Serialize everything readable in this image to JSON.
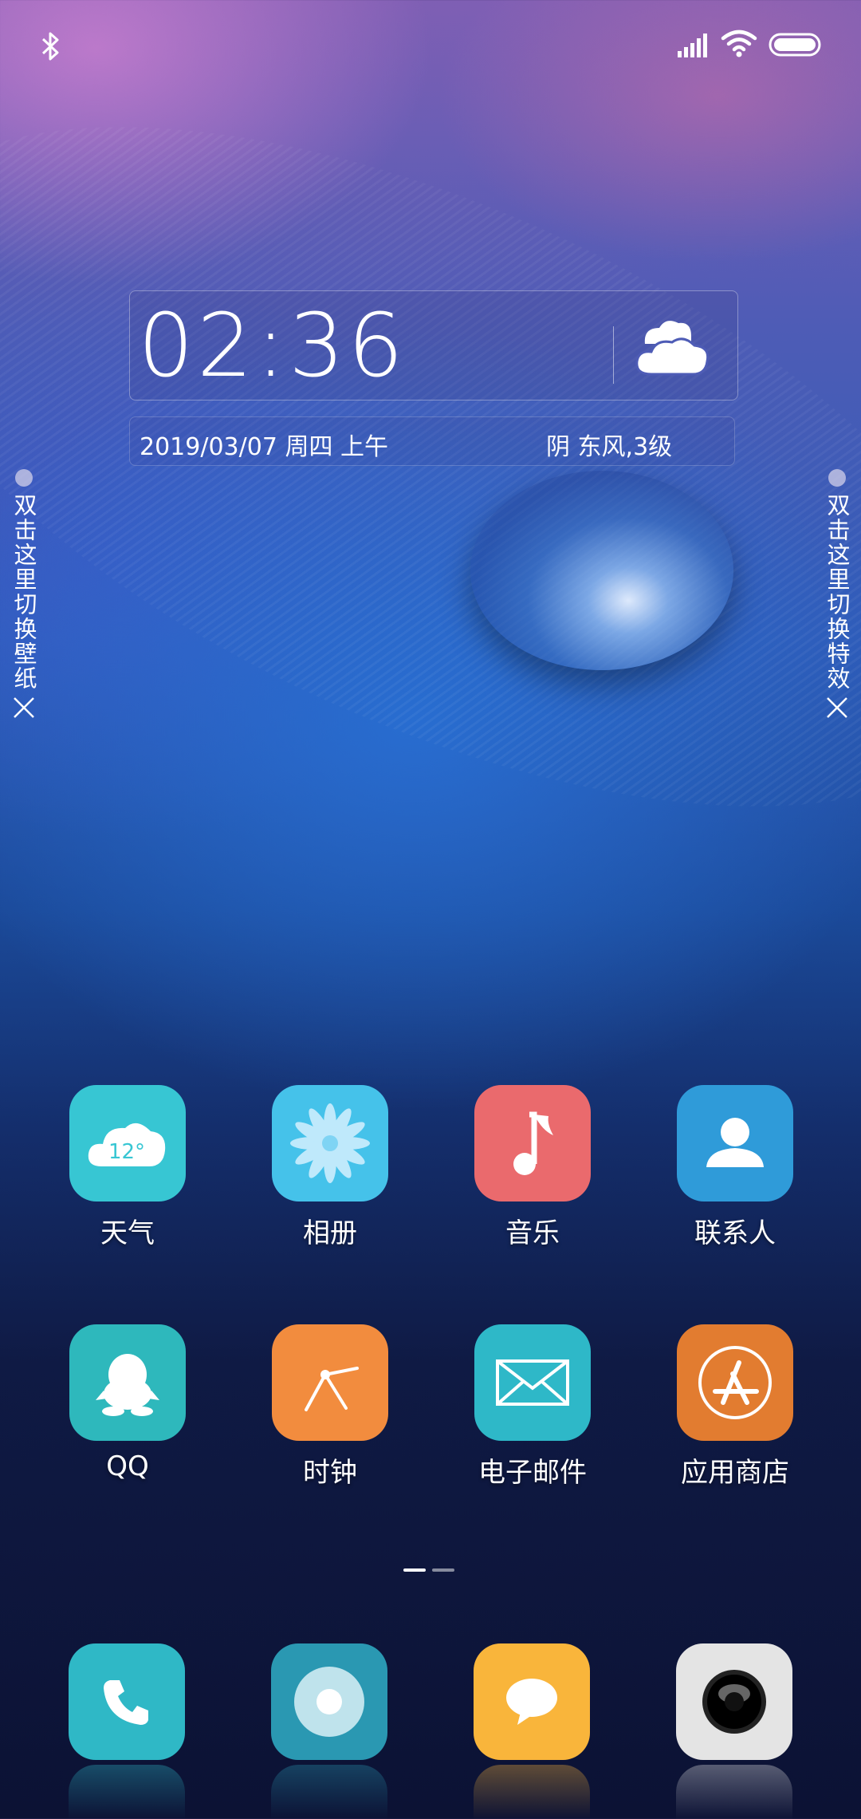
{
  "clock": {
    "time": "02:36"
  },
  "date_bar": {
    "date": "2019/03/07  周四  上午",
    "weather": "阴  东风,3级"
  },
  "side_hints": {
    "left": "双击这里切换壁纸",
    "right": "双击这里切换特效"
  },
  "apps": [
    {
      "label": "天气",
      "icon": "weather-icon",
      "color": "#37c6d3",
      "text": "12°"
    },
    {
      "label": "相册",
      "icon": "gallery-flower-icon",
      "color": "#45c2ea"
    },
    {
      "label": "音乐",
      "icon": "music-note-icon",
      "color": "#ea6a6d"
    },
    {
      "label": "联系人",
      "icon": "contacts-person-icon",
      "color": "#2f9bd9"
    },
    {
      "label": "QQ",
      "icon": "qq-penguin-icon",
      "color": "#2eb8bc"
    },
    {
      "label": "时钟",
      "icon": "clock-icon",
      "color": "#f28c3e"
    },
    {
      "label": "电子邮件",
      "icon": "mail-envelope-icon",
      "color": "#2eb8c8"
    },
    {
      "label": "应用商店",
      "icon": "app-store-icon",
      "color": "#e27c30"
    }
  ],
  "dock": [
    {
      "icon": "phone-icon",
      "color": "#2fb8c6"
    },
    {
      "icon": "browser-compass-icon",
      "color": "#2a98b2"
    },
    {
      "icon": "messages-bubble-icon",
      "color": "#f9b53b"
    },
    {
      "icon": "camera-icon",
      "color": "#e4e4e4"
    }
  ],
  "page_indicator": {
    "current": 1,
    "total": 2
  }
}
